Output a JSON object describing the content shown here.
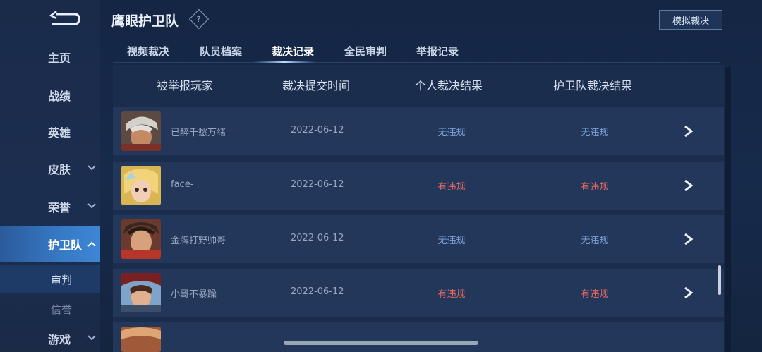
{
  "sidebar": {
    "back_icon": "back-arrow-icon",
    "items": [
      {
        "label": "主页"
      },
      {
        "label": "战绩"
      },
      {
        "label": "英雄"
      },
      {
        "label": "皮肤"
      },
      {
        "label": "荣誉"
      },
      {
        "label": "护卫队"
      },
      {
        "label": "审判"
      },
      {
        "label": "信誉"
      },
      {
        "label": "游戏"
      }
    ]
  },
  "header": {
    "title": "鹰眼护卫队",
    "help_glyph": "?",
    "simulate_button": "模拟裁决"
  },
  "tabs": [
    {
      "label": "视频裁决"
    },
    {
      "label": "队员档案"
    },
    {
      "label": "裁决记录"
    },
    {
      "label": "全民审判"
    },
    {
      "label": "举报记录"
    }
  ],
  "active_tab": "裁决记录",
  "table": {
    "headers": [
      "被举报玩家",
      "裁决提交时间",
      "个人裁决结果",
      "护卫队裁决结果"
    ],
    "rows": [
      {
        "player": "已醉千愁万绪",
        "date": "2022-06-12",
        "personal": "无违规",
        "team": "无违规"
      },
      {
        "player": "face-",
        "date": "2022-06-12",
        "personal": "有违规",
        "team": "有违规"
      },
      {
        "player": "金牌打野帅哥",
        "date": "2022-06-12",
        "personal": "无违规",
        "team": "无违规"
      },
      {
        "player": "小哥不暴躁",
        "date": "2022-06-12",
        "personal": "有违规",
        "team": "有违规"
      }
    ]
  },
  "colors": {
    "no_violation": "#7ea2d6",
    "violation": "#e26a63",
    "active_nav": "#3779c4"
  }
}
